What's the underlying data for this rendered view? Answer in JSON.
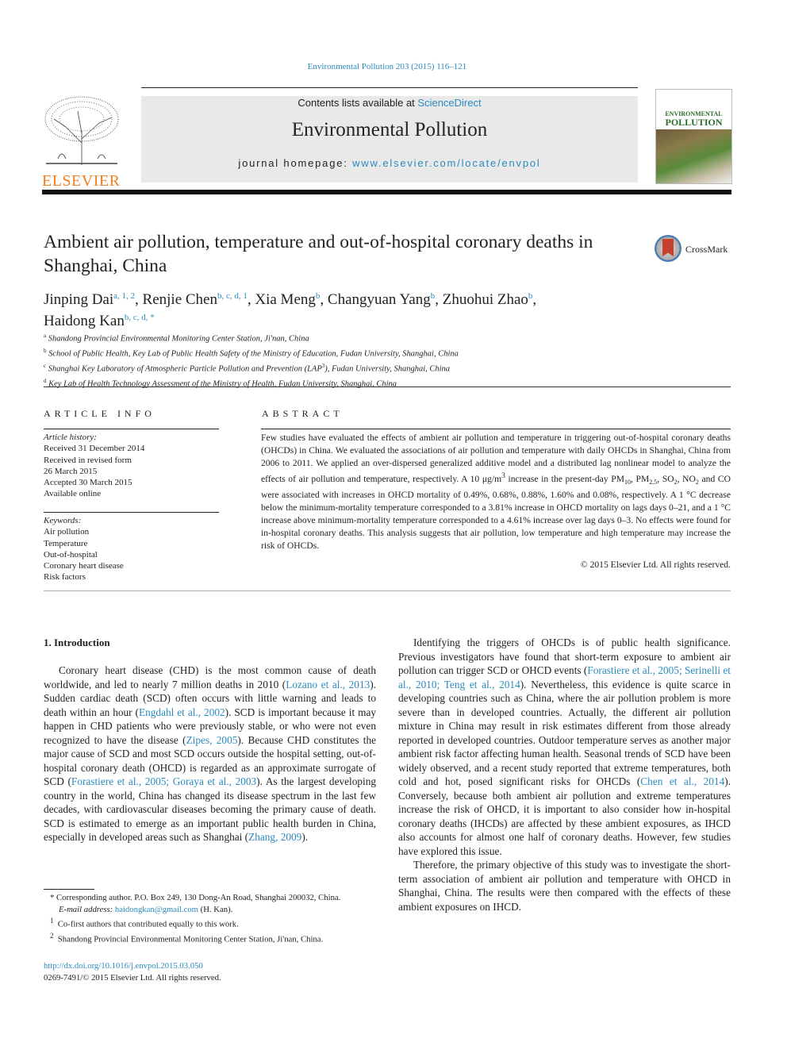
{
  "header": {
    "journal_ref": "Environmental Pollution 203 (2015) 116–121",
    "contents_prefix": "Contents lists available at ",
    "contents_link": "ScienceDirect",
    "journal_title": "Environmental Pollution",
    "homepage_prefix": "journal homepage: ",
    "homepage_link": "www.elsevier.com/locate/envpol",
    "publisher_logo": "ELSEVIER",
    "cover_title_line1": "ENVIRONMENTAL",
    "cover_title_line2": "POLLUTION",
    "accent_color": "#2a8bbf",
    "publisher_color": "#f07f1d"
  },
  "article": {
    "title": "Ambient air pollution, temperature and out-of-hospital coronary deaths in Shanghai, China",
    "crossmark_label": "CrossMark",
    "authors": [
      {
        "name": "Jinping Dai",
        "sup": "a, 1, 2",
        "sep": ", "
      },
      {
        "name": "Renjie Chen",
        "sup": "b, c, d, 1",
        "sep": ", "
      },
      {
        "name": "Xia Meng",
        "sup": "b",
        "sep": ", "
      },
      {
        "name": "Changyuan Yang",
        "sup": "b",
        "sep": ", "
      },
      {
        "name": "Zhuohui Zhao",
        "sup": "b",
        "sep": ","
      },
      {
        "name": "Haidong Kan",
        "sup": "b, c, d, *",
        "sep": ""
      }
    ],
    "affiliations": [
      {
        "key": "a",
        "text": "Shandong Provincial Environmental Monitoring Center Station, Ji'nan, China"
      },
      {
        "key": "b",
        "text": "School of Public Health, Key Lab of Public Health Safety of the Ministry of Education, Fudan University, Shanghai, China"
      },
      {
        "key": "c",
        "text_before": "Shanghai Key Laboratory of Atmospheric Particle Pollution and Prevention (LAP",
        "sup": "3",
        "text_after": "), Fudan University, Shanghai, China"
      },
      {
        "key": "d",
        "text": "Key Lab of Health Technology Assessment of the Ministry of Health, Fudan University, Shanghai, China"
      }
    ]
  },
  "article_info": {
    "heading": "ARTICLE INFO",
    "history_label": "Article history:",
    "history": [
      "Received 31 December 2014",
      "Received in revised form",
      "26 March 2015",
      "Accepted 30 March 2015",
      "Available online"
    ],
    "keywords_label": "Keywords:",
    "keywords": [
      "Air pollution",
      "Temperature",
      "Out-of-hospital",
      "Coronary heart disease",
      "Risk factors"
    ]
  },
  "abstract": {
    "heading": "ABSTRACT",
    "p1": "Few studies have evaluated the effects of ambient air pollution and temperature in triggering out-of-hospital coronary deaths (OHCDs) in China. We evaluated the associations of air pollution and temperature with daily OHCDs in Shanghai, China from 2006 to 2011. We applied an over-dispersed generalized additive model and a distributed lag nonlinear model to analyze the effects of air pollution and temperature, respectively. A 10 μg/m",
    "p1_sup": "3",
    "p2": " increase in the present-day PM",
    "pm10_sub": "10",
    "p3": ", PM",
    "pm25_sub": "2.5",
    "p4": ", SO",
    "so2_sub": "2",
    "p5": ", NO",
    "no2_sub": "2",
    "p6": " and CO were associated with increases in OHCD mortality of 0.49%, 0.68%, 0.88%, 1.60% and 0.08%, respectively. A 1 °C decrease below the minimum-mortality temperature corresponded to a 3.81% increase in OHCD mortality on lags days 0–21, and a 1 °C increase above minimum-mortality temperature corresponded to a 4.61% increase over lag days 0–3. No effects were found for in-hospital coronary deaths. This analysis suggests that air pollution, low temperature and high temperature may increase the risk of OHCDs.",
    "copyright": "© 2015 Elsevier Ltd. All rights reserved."
  },
  "body": {
    "section_heading": "1.  Introduction",
    "left_p1": [
      {
        "t": "Coronary heart disease (CHD) is the most common cause of death worldwide, and led to nearly 7 million deaths in 2010 ("
      },
      {
        "l": "Lozano et al., 2013"
      },
      {
        "t": "). Sudden cardiac death (SCD) often occurs with little warning and leads to death within an hour ("
      },
      {
        "l": "Engdahl et al., 2002"
      },
      {
        "t": "). SCD is important because it may happen in CHD patients who were previously stable, or who were not even recognized to have the disease ("
      },
      {
        "l": "Zipes, 2005"
      },
      {
        "t": "). Because CHD constitutes the major cause of SCD and most SCD occurs outside the hospital setting, out-of-hospital coronary death (OHCD) is regarded as an approximate surrogate of SCD ("
      },
      {
        "l": "Forastiere et al., 2005; Goraya et al., 2003"
      },
      {
        "t": "). As the largest developing country in the world, China has changed its disease spectrum in the last few decades, with cardiovascular diseases becoming the primary cause of death. SCD is estimated to emerge as an important public health burden in China, especially in developed areas such as Shanghai ("
      },
      {
        "l": "Zhang, 2009"
      },
      {
        "t": ")."
      }
    ],
    "right_p1": [
      {
        "t": "Identifying the triggers of OHCDs is of public health significance. Previous investigators have found that short-term exposure to ambient air pollution can trigger SCD or OHCD events ("
      },
      {
        "l": "Forastiere et al., 2005; Serinelli et al., 2010; Teng et al., 2014"
      },
      {
        "t": "). Nevertheless, this evidence is quite scarce in developing countries such as China, where the air pollution problem is more severe than in developed countries. Actually, the different air pollution mixture in China may result in risk estimates different from those already reported in developed countries. Outdoor temperature serves as another major ambient risk factor affecting human health. Seasonal trends of SCD have been widely observed, and a recent study reported that extreme temperatures, both cold and hot, posed significant risks for OHCDs ("
      },
      {
        "l": "Chen et al., 2014"
      },
      {
        "t": "). Conversely, because both ambient air pollution and extreme temperatures increase the risk of OHCD, it is important to also consider how in-hospital coronary deaths (IHCDs) are affected by these ambient exposures, as IHCD also accounts for almost one half of coronary deaths. However, few studies have explored this issue."
      }
    ],
    "right_p2": "Therefore, the primary objective of this study was to investigate the short-term association of ambient air pollution and temperature with OHCD in Shanghai, China. The results were then compared with the effects of these ambient exposures on IHCD."
  },
  "footnotes": {
    "corresponding": "* Corresponding author. P.O. Box 249, 130 Dong-An Road, Shanghai 200032, China.",
    "email_label": "E-mail address: ",
    "email": "haidongkan@gmail.com",
    "email_suffix": " (H. Kan).",
    "fn1_mark": "1",
    "fn1": "Co-first authors that contributed equally to this work.",
    "fn2_mark": "2",
    "fn2": "Shandong Provincial Environmental Monitoring Center Station, Ji'nan, China.",
    "doi": "http://dx.doi.org/10.1016/j.envpol.2015.03.050",
    "issn": "0269-7491/© 2015 Elsevier Ltd. All rights reserved."
  }
}
